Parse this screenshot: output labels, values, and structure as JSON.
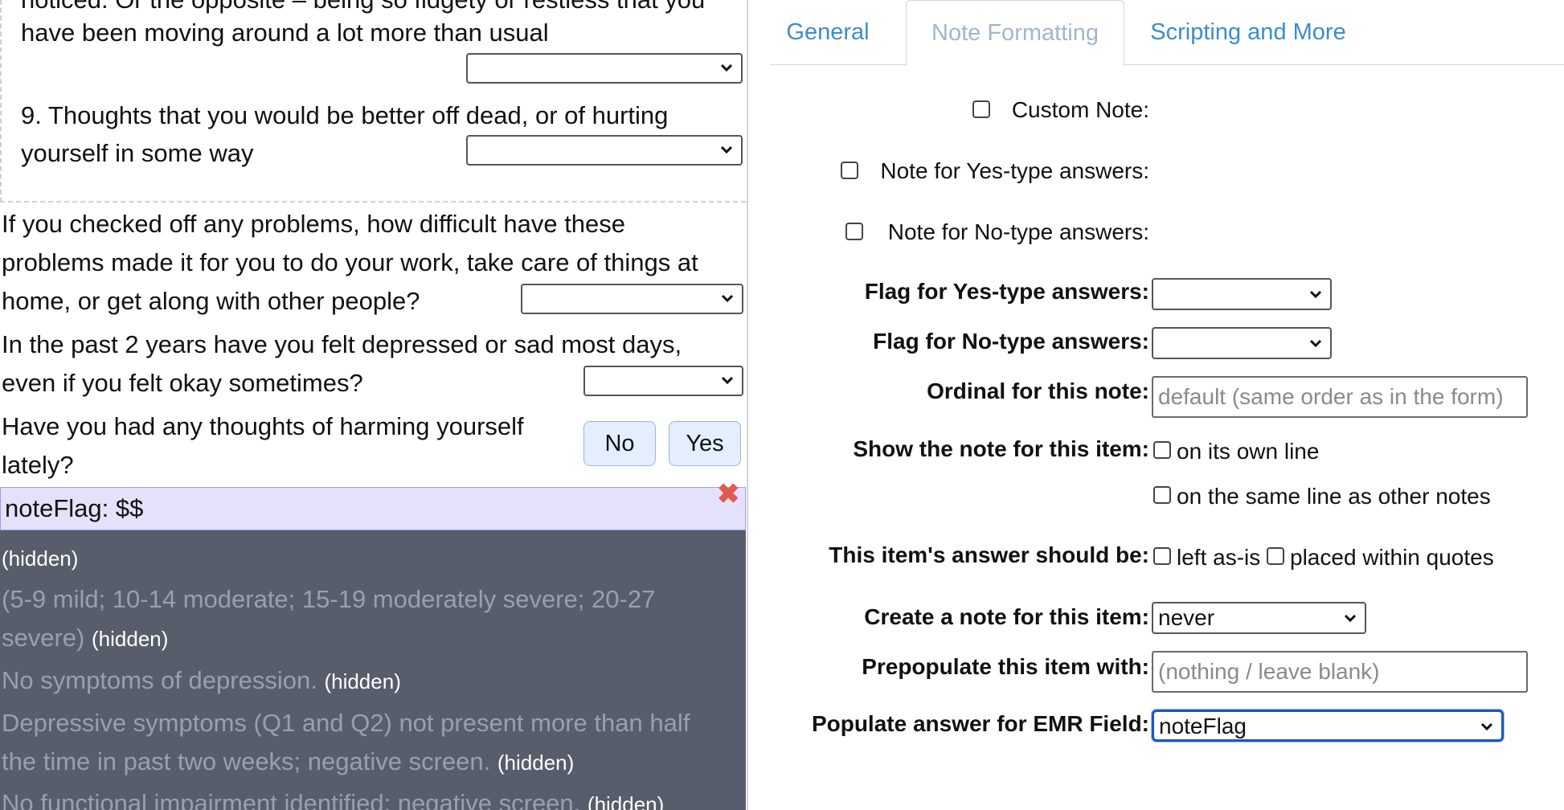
{
  "form": {
    "q8_tail_top": "noticed. Or the opposite – being so fidgety or restless that you",
    "q8_tail_bottom": "have been moving around a lot more than usual",
    "q9_line1": "9. Thoughts that you would be better off dead, or of hurting",
    "q9_line2": "yourself in some way",
    "difficulty_line1": "If you checked off any problems, how difficult have these",
    "difficulty_line2": "problems made it for you to do your work, take care of things at",
    "difficulty_line3": "home, or get along with other people?",
    "two_years_line1": "In the past 2 years have you felt depressed or sad most days,",
    "two_years_line2": "even if you felt okay sometimes?",
    "harming_line1": "Have you had any thoughts of harming yourself",
    "harming_line2": "lately?",
    "no_label": "No",
    "yes_label": "Yes"
  },
  "note_flag": {
    "text": "noteFlag: $$",
    "close_glyph": "✖"
  },
  "hidden_notes": {
    "hidden_tag": "(hidden)",
    "scale_line1": "(5-9 mild; 10-14 moderate; 15-19 moderately severe; 20-27",
    "scale_line2": "severe)",
    "no_symptoms": "No symptoms of depression.",
    "depressive_line1": "Depressive symptoms (Q1 and Q2) not present more than half",
    "depressive_line2": "the time in past two weeks; negative screen.",
    "no_functional": "No functional impairment identified; negative screen."
  },
  "tabs": [
    {
      "label": "General",
      "active": false
    },
    {
      "label": "Note Formatting",
      "active": true
    },
    {
      "label": "Scripting and More",
      "active": false
    }
  ],
  "settings": {
    "custom_note": "Custom Note:",
    "note_yes": "Note for Yes-type answers:",
    "note_no": "Note for No-type answers:",
    "flag_yes": "Flag for Yes-type answers:",
    "flag_no": "Flag for No-type answers:",
    "ordinal_label": "Ordinal for this note:",
    "ordinal_placeholder": "default (same order as in the form)",
    "show_note_label": "Show the note for this item:",
    "own_line": "on its own line",
    "same_line": "on the same line as other notes",
    "answer_label": "This item's answer should be:",
    "left_as_is": "left as-is",
    "within_quotes": "placed within quotes",
    "create_note_label": "Create a note for this item:",
    "create_note_value": "never",
    "prepopulate_label": "Prepopulate this item with:",
    "prepopulate_placeholder": "(nothing / leave blank)",
    "emr_label": "Populate answer for EMR Field:",
    "emr_value": "noteFlag"
  },
  "colors": {
    "tab_link": "#3c8dcc",
    "tab_active_text": "#a4b6c8",
    "note_flag_bg": "#e4e2fa",
    "hidden_panel_bg": "#585d6b",
    "close_icon": "#e05a4f",
    "focus_border": "#1f55c4"
  }
}
